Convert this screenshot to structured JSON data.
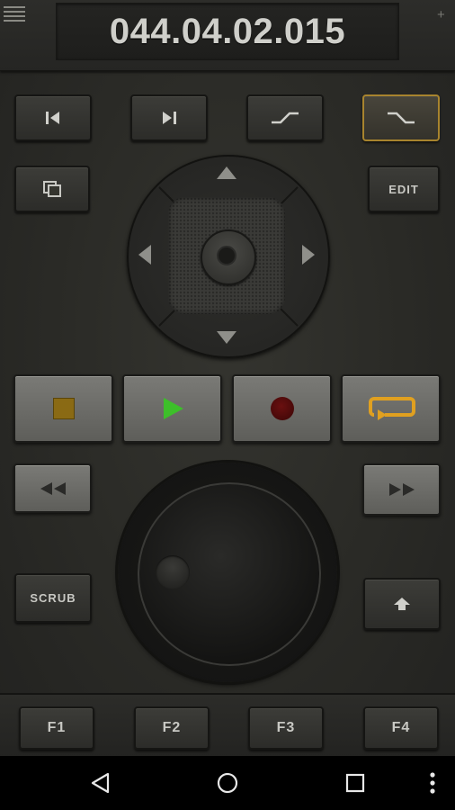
{
  "header": {
    "timecode": "044.04.02.015",
    "menu_icon": "hamburger-menu-icon",
    "plus_icon": "+"
  },
  "top_row": [
    {
      "name": "previous-button",
      "icon": "skip-previous-icon"
    },
    {
      "name": "next-button",
      "icon": "skip-next-icon"
    },
    {
      "name": "mark-in-button",
      "icon": "curve-in-icon"
    },
    {
      "name": "mark-out-button",
      "icon": "curve-out-icon",
      "active": true
    }
  ],
  "side_buttons": {
    "copy_icon": "copy-icon",
    "edit_label": "EDIT",
    "scrub_label": "SCRUB",
    "shift_icon": "arrow-up-icon"
  },
  "transport": {
    "stop_color": "#8a6a14",
    "play_color": "#3dbf2a",
    "record_color": "#4a0a0a",
    "loop_color": "#e0a020"
  },
  "function_keys": [
    "F1",
    "F2",
    "F3",
    "F4"
  ],
  "accent_color": "#a8842e",
  "navbar": [
    "back-icon",
    "home-icon",
    "recents-icon",
    "more-icon"
  ]
}
